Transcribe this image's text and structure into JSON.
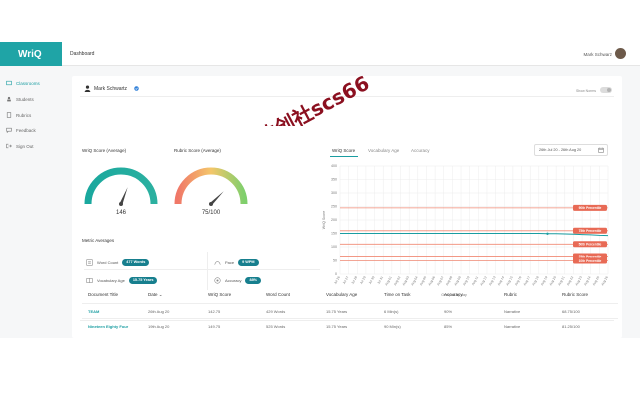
{
  "app": {
    "logo": "WriQ",
    "page_title": "Dashboard",
    "user_name": "Mark Schwarz"
  },
  "sidebar": {
    "items": [
      {
        "label": "Classrooms",
        "icon": "classroom-icon",
        "active": true
      },
      {
        "label": "Students",
        "icon": "student-icon",
        "active": false
      },
      {
        "label": "Rubrics",
        "icon": "rubric-icon",
        "active": false
      },
      {
        "label": "Feedback",
        "icon": "feedback-icon",
        "active": false
      },
      {
        "label": "Sign Out",
        "icon": "sign-out-icon",
        "active": false
      }
    ]
  },
  "student": {
    "name": "Mark Schwartz",
    "show_norms_label": "Show Norms"
  },
  "scores": {
    "writq_label": "WriQ Score (Average)",
    "writq_value": "146",
    "writq_fraction": 0.62,
    "rubric_label": "Rubric Score (Average)",
    "rubric_value": "75/100",
    "rubric_fraction": 0.75
  },
  "metrics": {
    "title": "Metric Averages",
    "items": [
      {
        "label": "Word Count",
        "value": "477 Words",
        "icon": "word-count-icon"
      },
      {
        "label": "Pace",
        "value": "9 WPM",
        "icon": "pace-icon"
      },
      {
        "label": "Vocabulary Age",
        "value": "15.75 Years",
        "icon": "vocabulary-icon"
      },
      {
        "label": "Accuracy",
        "value": "88%",
        "icon": "accuracy-icon"
      }
    ]
  },
  "chart_tabs": [
    "WriQ Score",
    "Vocabulary Age",
    "Accuracy"
  ],
  "date_range": "26th Jul 20 - 26th Aug 20",
  "chart_data": {
    "type": "line",
    "ylabel": "WriQ Score",
    "xlabel": "Grouped by day",
    "ylim": [
      0,
      400
    ],
    "yticks": [
      "0",
      "50",
      "100",
      "150",
      "200",
      "250",
      "300",
      "350",
      "400"
    ],
    "categories": [
      "Jul 26",
      "Jul 27",
      "Jul 28",
      "Jul 29",
      "Jul 30",
      "Jul 31",
      "Aug 01",
      "Aug 02",
      "Aug 03",
      "Aug 04",
      "Aug 05",
      "Aug 06",
      "Aug 07",
      "Aug 08",
      "Aug 09",
      "Aug 10",
      "Aug 11",
      "Aug 12",
      "Aug 13",
      "Aug 14",
      "Aug 15",
      "Aug 16",
      "Aug 17",
      "Aug 18",
      "Aug 19",
      "Aug 20",
      "Aug 21",
      "Aug 22",
      "Aug 23",
      "Aug 24",
      "Aug 25",
      "Aug 26"
    ],
    "series": [
      {
        "values": [
          150,
          150,
          150,
          150,
          150,
          150,
          150,
          150,
          150,
          150,
          150,
          150,
          150,
          150,
          150,
          150,
          150,
          150,
          150,
          150,
          150,
          150,
          150,
          150,
          149,
          149,
          148,
          147,
          146,
          145,
          143,
          142
        ]
      }
    ],
    "percentiles": [
      {
        "label": "90th Percentile",
        "value": 245
      },
      {
        "label": "75th Percentile",
        "value": 160
      },
      {
        "label": "50th Percentile",
        "value": 110
      },
      {
        "label": "25th Percentile",
        "value": 65
      },
      {
        "label": "10th Percentile",
        "value": 50
      }
    ],
    "line_color": "#1a9da1",
    "percentile_color": "#f08a74"
  },
  "table": {
    "headers": [
      "Document Title",
      "Date",
      "WriQ Score",
      "Word Count",
      "Vocabulary Age",
      "Time on Task",
      "Accuracy",
      "Rubric",
      "Rubric Score"
    ],
    "rows": [
      [
        "TEAM",
        "26th Aug 20",
        "142.75",
        "429 Words",
        "15.75 Years",
        "6 Min(s)",
        "90%",
        "Narrative",
        "68.75/100"
      ],
      [
        "Nineteen Eighty Four",
        "19th Aug 20",
        "149.75",
        "525 Words",
        "15.75 Years",
        "90 Min(s)",
        "85%",
        "Narrative",
        "81.25/100"
      ]
    ]
  },
  "watermark": "数创社scs66",
  "colors": {
    "brand": "#1fa4a6",
    "accent": "#177f8e",
    "percentile": "#f08a74"
  }
}
